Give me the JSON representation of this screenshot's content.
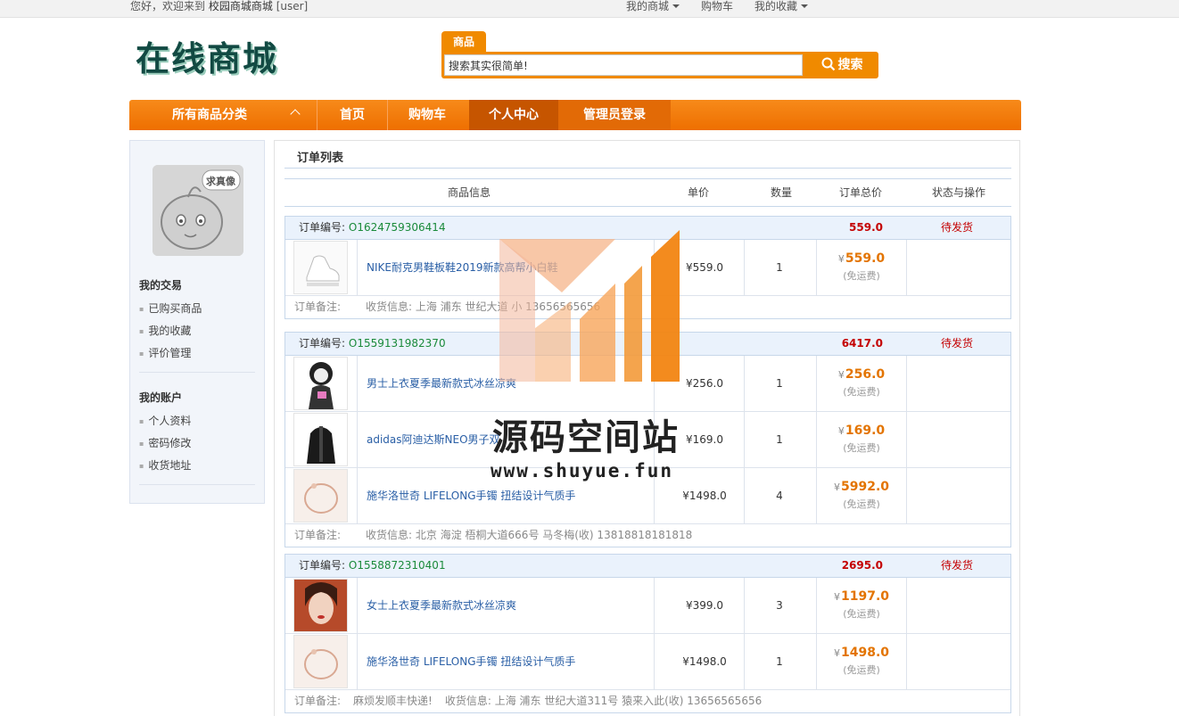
{
  "topbar": {
    "welcome_prefix": "您好，欢迎来到",
    "site_name": "校园商城商城",
    "user": "[user]",
    "links": [
      "我的商城",
      "购物车",
      "我的收藏"
    ]
  },
  "header": {
    "logo_text": "在线商城",
    "search_tab": "商品",
    "search_value": "搜索其实很简单!",
    "search_button": "搜索"
  },
  "nav": {
    "category": "所有商品分类",
    "items": [
      "首页",
      "购物车",
      "个人中心",
      "管理员登录"
    ],
    "active": "个人中心"
  },
  "sidebar": {
    "avatar_badge": "求真像",
    "section1": {
      "title": "我的交易",
      "links": [
        "已购买商品",
        "我的收藏",
        "评价管理"
      ]
    },
    "section2": {
      "title": "我的账户",
      "links": [
        "个人资料",
        "密码修改",
        "收货地址"
      ]
    }
  },
  "main": {
    "title": "订单列表",
    "headers": [
      "商品信息",
      "单价",
      "数量",
      "订单总价",
      "状态与操作"
    ],
    "order_no_label": "订单编号:",
    "remark_label": "订单备注:",
    "currency": "¥",
    "shipping_note": "(免运费)",
    "orders": [
      {
        "no": "O1624759306414",
        "total": "559.0",
        "status": "待发货",
        "items": [
          {
            "name": "NIKE耐克男鞋板鞋2019新款高帮小白鞋",
            "price": "¥559.0",
            "qty": "1",
            "subtotal": "559.0"
          }
        ],
        "remark": "",
        "address": "收货信息: 上海 浦东 世纪大道 小 13656565656"
      },
      {
        "no": "O1559131982370",
        "total": "6417.0",
        "status": "待发货",
        "items": [
          {
            "name": "男士上衣夏季最新款式冰丝凉爽",
            "price": "¥256.0",
            "qty": "1",
            "subtotal": "256.0"
          },
          {
            "name": "adidas阿迪达斯NEO男子双",
            "price": "¥169.0",
            "qty": "1",
            "subtotal": "169.0"
          },
          {
            "name": "施华洛世奇 LIFELONG手镯 扭结设计气质手",
            "price": "¥1498.0",
            "qty": "4",
            "subtotal": "5992.0"
          }
        ],
        "remark": "",
        "address": "收货信息: 北京 海淀 梧桐大道666号 马冬梅(收) 13818818181818"
      },
      {
        "no": "O1558872310401",
        "total": "2695.0",
        "status": "待发货",
        "items": [
          {
            "name": "女士上衣夏季最新款式冰丝凉爽",
            "price": "¥399.0",
            "qty": "3",
            "subtotal": "1197.0"
          },
          {
            "name": "施华洛世奇 LIFELONG手镯 扭结设计气质手",
            "price": "¥1498.0",
            "qty": "1",
            "subtotal": "1498.0"
          }
        ],
        "remark": "麻烦发顺丰快递!",
        "address": "收货信息: 上海 浦东 世纪大道311号 猿来入此(收) 13656565656"
      }
    ]
  },
  "watermark": {
    "title": "源码空间站",
    "url": "www.shuyue.fun"
  }
}
